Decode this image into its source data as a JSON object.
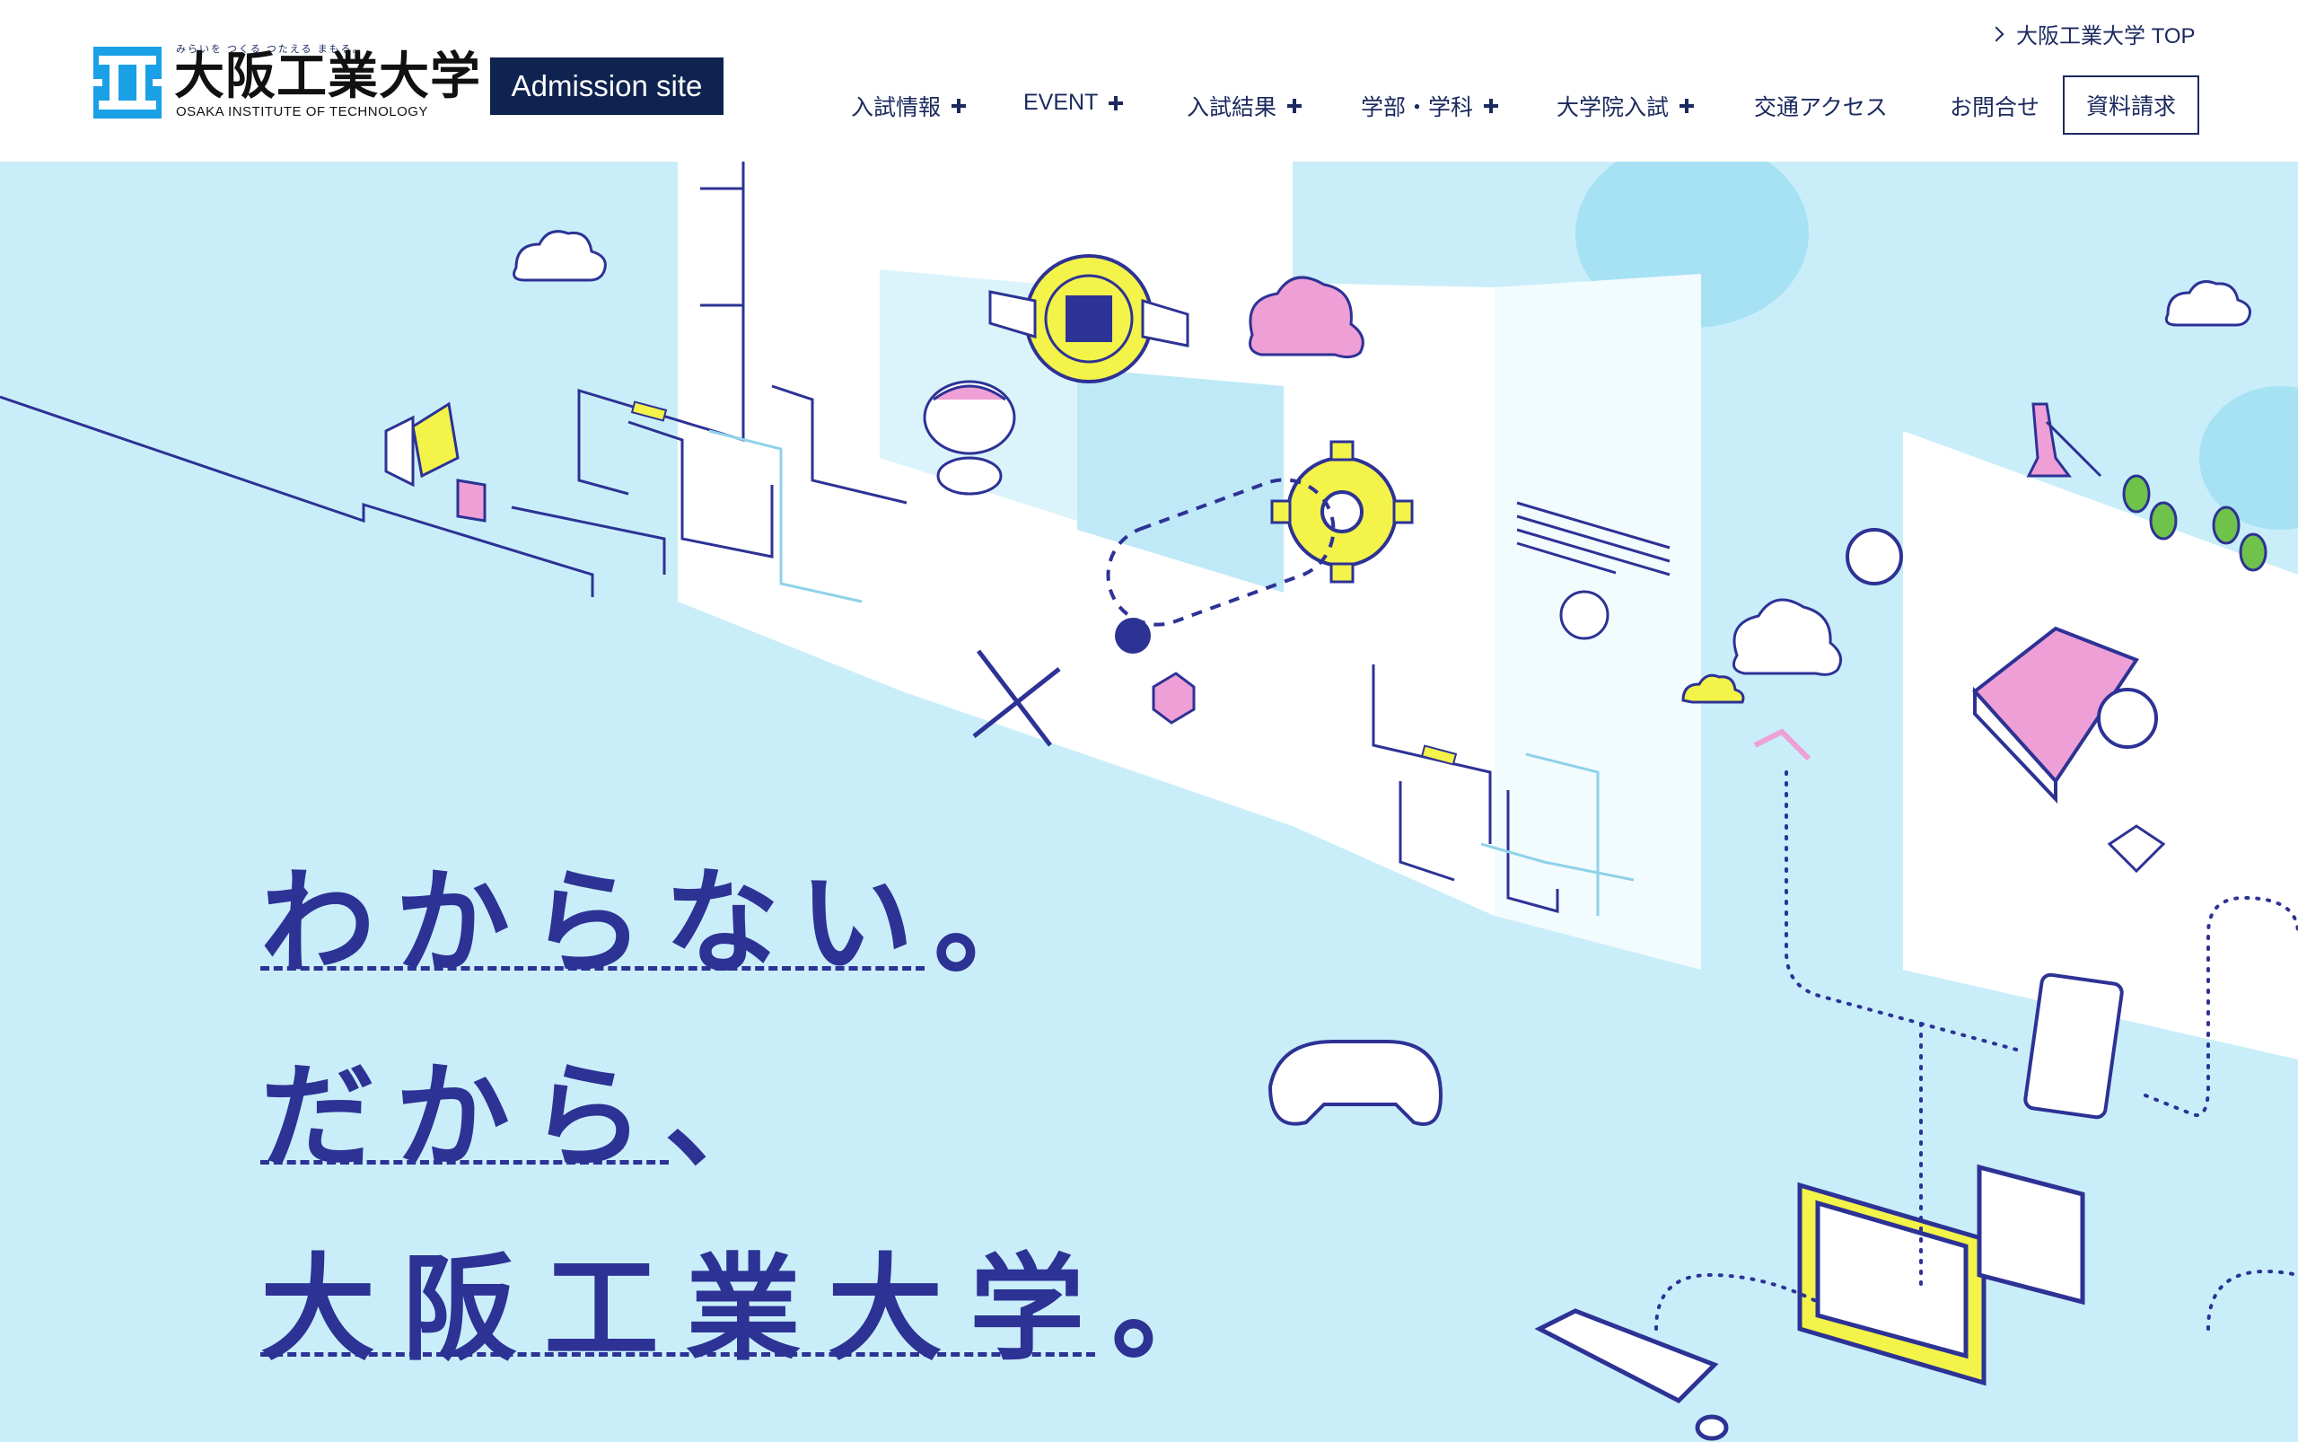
{
  "header": {
    "logo": {
      "tagline": "みらいを つくる つたえる まもる。",
      "name": "大阪工業大学",
      "name_en": "OSAKA INSTITUTE OF TECHNOLOGY"
    },
    "admission_label": "Admission site",
    "top_link": "大阪工業大学 TOP",
    "nav": [
      {
        "label": "入試情報",
        "expand": true
      },
      {
        "label": "EVENT",
        "expand": true
      },
      {
        "label": "入試結果",
        "expand": true
      },
      {
        "label": "学部・学科",
        "expand": true
      },
      {
        "label": "大学院入試",
        "expand": true
      },
      {
        "label": "交通アクセス",
        "expand": false
      },
      {
        "label": "お問合せ",
        "expand": false
      }
    ],
    "request_label": "資料請求"
  },
  "hero": {
    "line1": "わからない。",
    "line2": "だから、",
    "line3": "大阪工業大学。"
  },
  "colors": {
    "navy": "#0f2350",
    "indigo": "#2d3295",
    "sky": "#c9eef9",
    "yellow": "#f3f34a",
    "pink": "#ee9fd6",
    "logo_blue": "#1aa0e6"
  }
}
